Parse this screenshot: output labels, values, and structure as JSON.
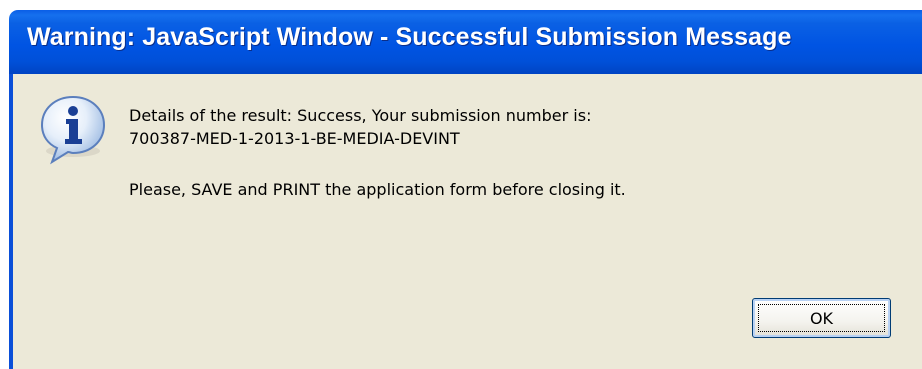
{
  "window": {
    "title": "Warning: JavaScript Window - Successful Submission Message"
  },
  "message": {
    "line1": "Details of the result: Success, Your submission number is:",
    "line2": "700387-MED-1-2013-1-BE-MEDIA-DEVINT",
    "line3": "Please, SAVE and PRINT the application form before closing it."
  },
  "icon": "information-icon",
  "buttons": {
    "ok_label": "OK"
  },
  "colors": {
    "titlebar": "#0054e3",
    "dialog_background": "#ece9d8",
    "title_text": "#ffffff"
  }
}
